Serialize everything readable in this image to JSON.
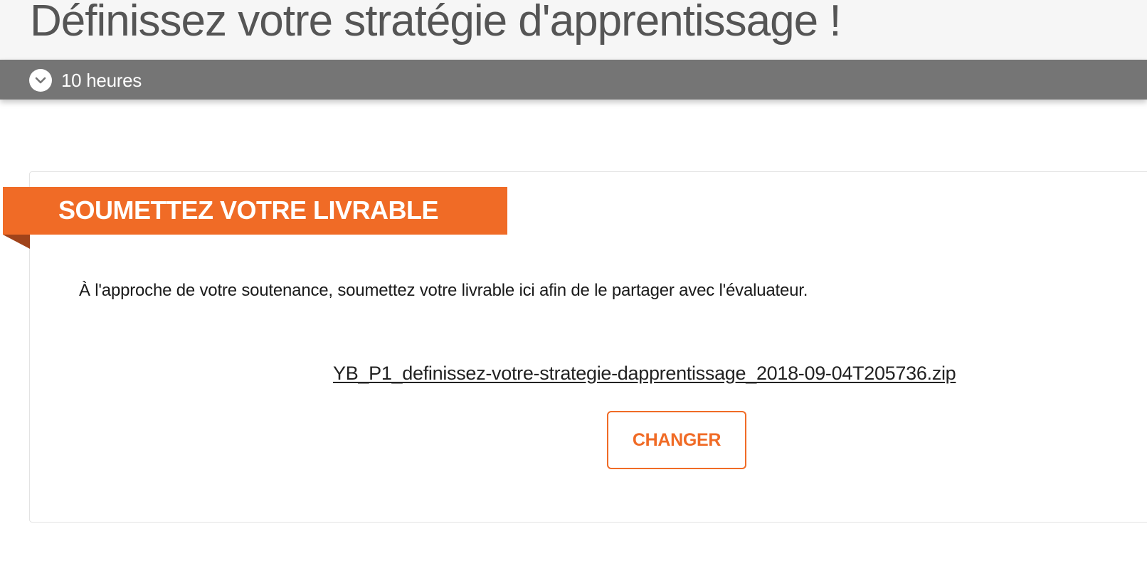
{
  "header": {
    "title": "Définissez votre stratégie d'apprentissage !"
  },
  "duration_bar": {
    "toggle_icon": "chevron-down-icon",
    "duration": "10 heures",
    "background_color": "#757575"
  },
  "deliverable": {
    "ribbon_title": "SOUMETTEZ VOTRE LIVRABLE",
    "description": "À l'approche de votre soutenance, soumettez votre livrable ici afin de le partager avec l'évaluateur.",
    "file_name": "YB_P1_definissez-votre-strategie-dapprentissage_2018-09-04T205736.zip",
    "change_label": "CHANGER"
  },
  "colors": {
    "accent": "#f06b26",
    "ribbon_fold": "#a0431a",
    "title_text": "#555555"
  }
}
